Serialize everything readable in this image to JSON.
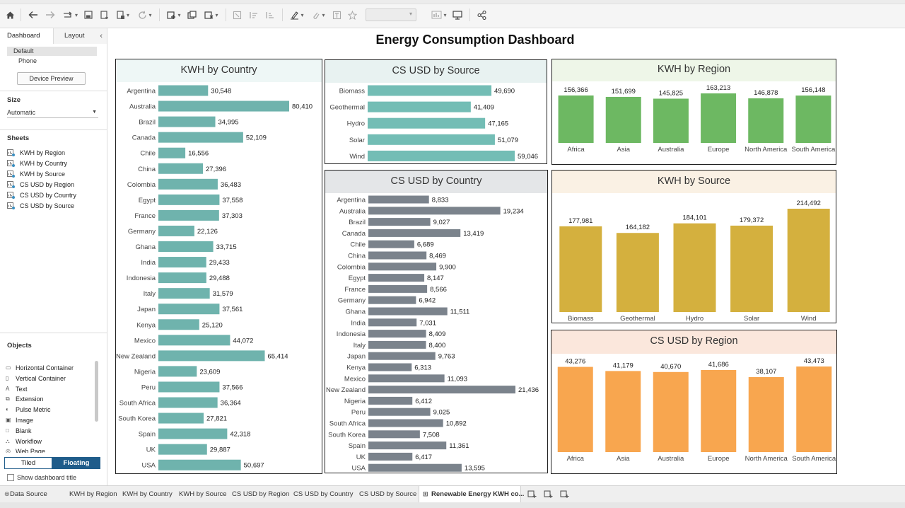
{
  "toolbar": {
    "buttons": [
      {
        "name": "home-icon"
      },
      {
        "name": "undo-icon"
      },
      {
        "name": "redo-icon"
      },
      {
        "name": "replay-icon"
      },
      {
        "name": "save-icon"
      },
      {
        "name": "new-data-source-icon"
      },
      {
        "name": "pause-updates-icon"
      },
      {
        "name": "refresh-icon"
      },
      {
        "name": "new-worksheet-icon"
      },
      {
        "name": "duplicate-sheet-icon"
      },
      {
        "name": "clear-sheet-icon"
      },
      {
        "name": "swap-icon"
      },
      {
        "name": "sort-ascending-icon"
      },
      {
        "name": "sort-descending-icon"
      },
      {
        "name": "highlight-icon"
      },
      {
        "name": "group-icon"
      },
      {
        "name": "labels-icon"
      },
      {
        "name": "fix-axes-icon"
      },
      {
        "name": "fit-select"
      },
      {
        "name": "show-me-icon"
      },
      {
        "name": "presentation-icon"
      },
      {
        "name": "share-icon"
      }
    ]
  },
  "left_panel": {
    "tabs": {
      "dashboard": "Dashboard",
      "layout": "Layout"
    },
    "device": {
      "default": "Default",
      "phone": "Phone",
      "preview_button": "Device Preview"
    },
    "size": {
      "header": "Size",
      "value": "Automatic"
    },
    "sheets": {
      "header": "Sheets",
      "items": [
        "KWH by Region",
        "KWH by Country",
        "KWH by Source",
        "CS USD by Region",
        "CS USD by Country",
        "CS USD by Source"
      ]
    },
    "objects": {
      "header": "Objects",
      "items": [
        "Horizontal Container",
        "Vertical Container",
        "Text",
        "Extension",
        "Pulse Metric",
        "Image",
        "Blank",
        "Workflow",
        "Web Page"
      ]
    },
    "layout_toggle": {
      "tiled": "Tiled",
      "floating": "Floating"
    },
    "show_title": "Show dashboard title"
  },
  "bottom_tabs": [
    "Data Source",
    "KWH by Region",
    "KWH by Country",
    "KWH by Source",
    "CS USD by Region",
    "CS USD by Country",
    "CS USD by Source",
    "Renewable Energy KWH co..."
  ],
  "active_tab_index": 7,
  "dashboard": {
    "title": "Energy Consumption Dashboard"
  },
  "colors": {
    "teal": "#6fb3ad",
    "teal_light": "#73bdb5",
    "gray": "#7b838c",
    "green": "#6db862",
    "gold": "#d4b03e",
    "orange": "#f8a64f",
    "accent_blue": "#1f5c8a"
  },
  "chart_data": [
    {
      "id": "kwh_by_country",
      "type": "bar",
      "orientation": "horizontal",
      "title": "KWH by Country",
      "categories": [
        "Argentina",
        "Australia",
        "Brazil",
        "Canada",
        "Chile",
        "China",
        "Colombia",
        "Egypt",
        "France",
        "Germany",
        "Ghana",
        "India",
        "Indonesia",
        "Italy",
        "Japan",
        "Kenya",
        "Mexico",
        "New Zealand",
        "Nigeria",
        "Peru",
        "South Africa",
        "South Korea",
        "Spain",
        "UK",
        "USA"
      ],
      "values": [
        30548,
        80410,
        34995,
        52109,
        16556,
        27396,
        36483,
        37558,
        37303,
        22126,
        33715,
        29433,
        29488,
        31579,
        37561,
        25120,
        44072,
        65414,
        23609,
        37566,
        36364,
        27821,
        42318,
        29887,
        50697
      ],
      "labels": [
        "30,548",
        "80,410",
        "34,995",
        "52,109",
        "16,556",
        "27,396",
        "36,483",
        "37,558",
        "37,303",
        "22,126",
        "33,715",
        "29,433",
        "29,488",
        "31,579",
        "37,561",
        "25,120",
        "44,072",
        "65,414",
        "23,609",
        "37,566",
        "36,364",
        "27,821",
        "42,318",
        "29,887",
        "50,697"
      ],
      "color": "#6fb3ad"
    },
    {
      "id": "cs_usd_by_source",
      "type": "bar",
      "orientation": "horizontal",
      "title": "CS USD by Source",
      "categories": [
        "Biomass",
        "Geothermal",
        "Hydro",
        "Solar",
        "Wind"
      ],
      "values": [
        49690,
        41409,
        47165,
        51079,
        59046
      ],
      "labels": [
        "49,690",
        "41,409",
        "47,165",
        "51,079",
        "59,046"
      ],
      "color": "#73bdb5"
    },
    {
      "id": "cs_usd_by_country",
      "type": "bar",
      "orientation": "horizontal",
      "title": "CS USD by Country",
      "categories": [
        "Argentina",
        "Australia",
        "Brazil",
        "Canada",
        "Chile",
        "China",
        "Colombia",
        "Egypt",
        "France",
        "Germany",
        "Ghana",
        "India",
        "Indonesia",
        "Italy",
        "Japan",
        "Kenya",
        "Mexico",
        "New Zealand",
        "Nigeria",
        "Peru",
        "South Africa",
        "South Korea",
        "Spain",
        "UK",
        "USA"
      ],
      "values": [
        8833,
        19234,
        9027,
        13419,
        6689,
        8469,
        9900,
        8147,
        8566,
        6942,
        11511,
        7031,
        8409,
        8400,
        9763,
        6313,
        11093,
        21436,
        6412,
        9025,
        10892,
        7508,
        11361,
        6417,
        13595
      ],
      "labels": [
        "8,833",
        "19,234",
        "9,027",
        "13,419",
        "6,689",
        "8,469",
        "9,900",
        "8,147",
        "8,566",
        "6,942",
        "11,511",
        "7,031",
        "8,409",
        "8,400",
        "9,763",
        "6,313",
        "11,093",
        "21,436",
        "6,412",
        "9,025",
        "10,892",
        "7,508",
        "11,361",
        "6,417",
        "13,595"
      ],
      "color": "#7b838c"
    },
    {
      "id": "kwh_by_region",
      "type": "bar",
      "orientation": "vertical",
      "title": "KWH by Region",
      "categories": [
        "Africa",
        "Asia",
        "Australia",
        "Europe",
        "North America",
        "South America"
      ],
      "values": [
        156366,
        151699,
        145825,
        163213,
        146878,
        156148
      ],
      "labels": [
        "156,366",
        "151,699",
        "145,825",
        "163,213",
        "146,878",
        "156,148"
      ],
      "color": "#6db862"
    },
    {
      "id": "kwh_by_source",
      "type": "bar",
      "orientation": "vertical",
      "title": "KWH by Source",
      "categories": [
        "Biomass",
        "Geothermal",
        "Hydro",
        "Solar",
        "Wind"
      ],
      "values": [
        177981,
        164182,
        184101,
        179372,
        214492
      ],
      "labels": [
        "177,981",
        "164,182",
        "184,101",
        "179,372",
        "214,492"
      ],
      "color": "#d4b03e"
    },
    {
      "id": "cs_usd_by_region",
      "type": "bar",
      "orientation": "vertical",
      "title": "CS USD by Region",
      "categories": [
        "Africa",
        "Asia",
        "Australia",
        "Europe",
        "North America",
        "South America"
      ],
      "values": [
        43276,
        41179,
        40670,
        41686,
        38107,
        43473
      ],
      "labels": [
        "43,276",
        "41,179",
        "40,670",
        "41,686",
        "38,107",
        "43,473"
      ],
      "color": "#f8a64f"
    }
  ]
}
